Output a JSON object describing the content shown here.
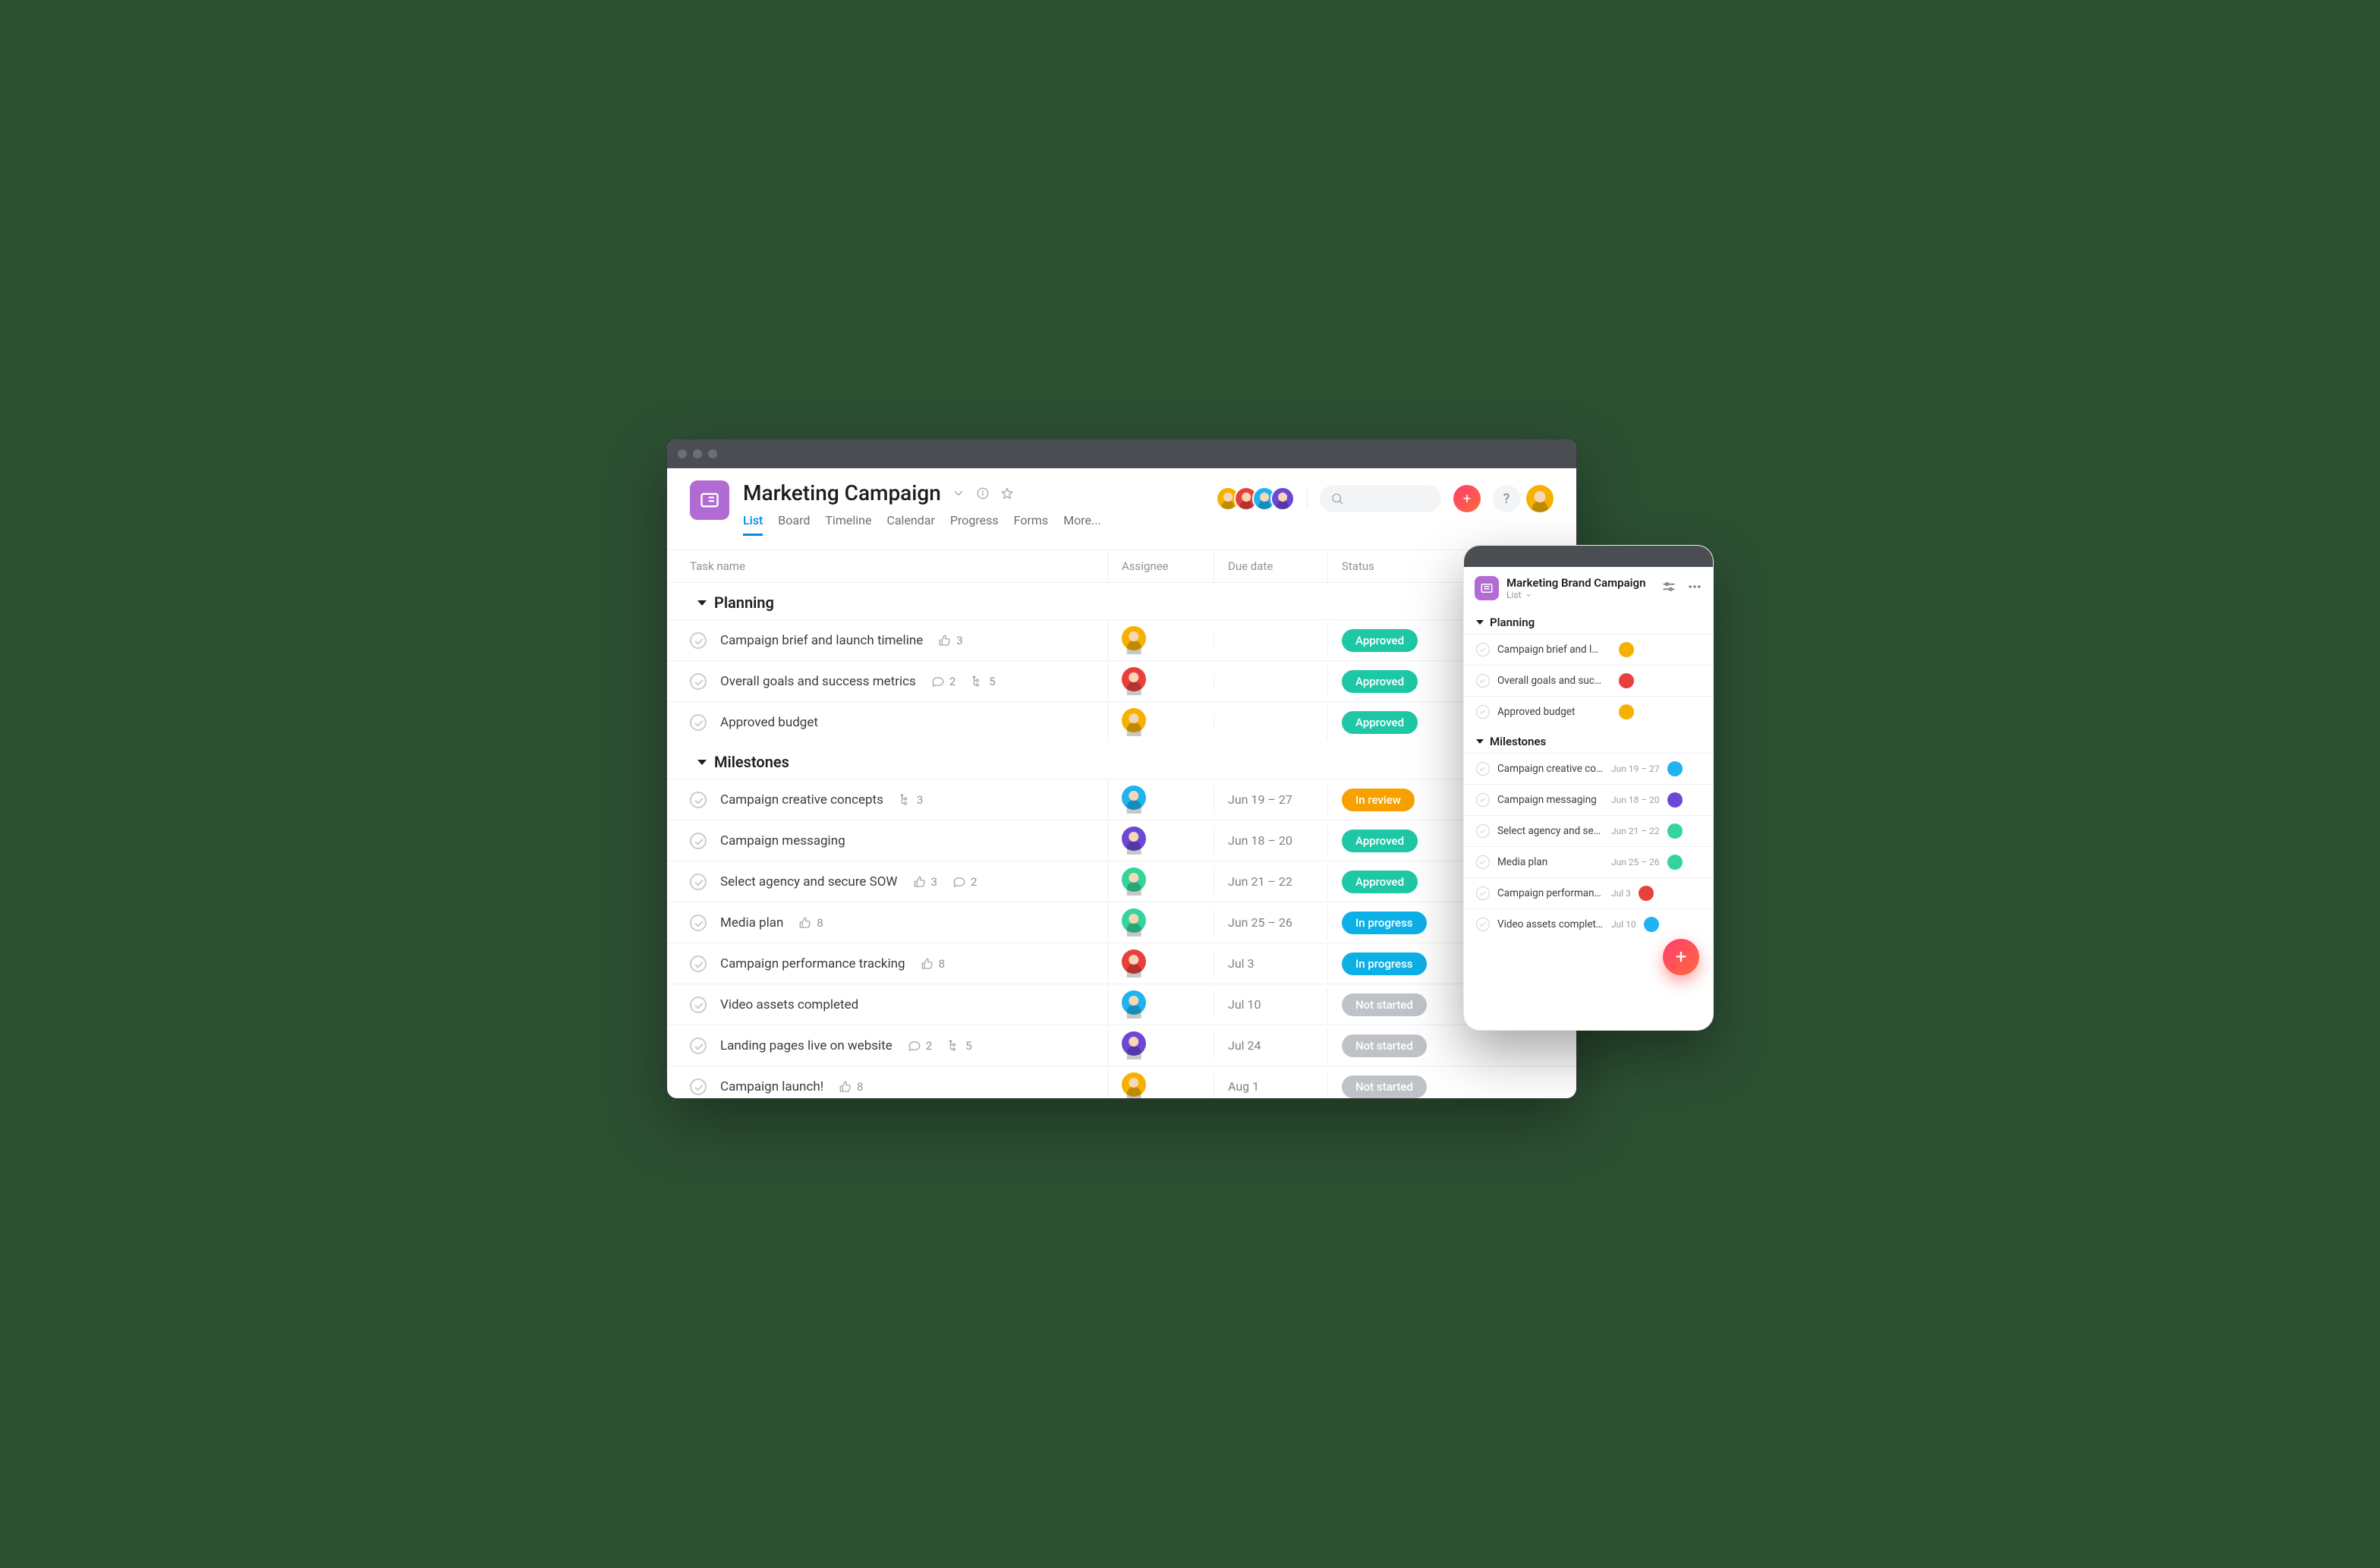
{
  "project": {
    "title": "Marketing Campaign",
    "tabs": [
      "List",
      "Board",
      "Timeline",
      "Calendar",
      "Progress",
      "Forms",
      "More..."
    ],
    "active_tab": 0
  },
  "columns": {
    "task": "Task name",
    "assignee": "Assignee",
    "due": "Due date",
    "status": "Status"
  },
  "status_labels": {
    "approved": "Approved",
    "review": "In review",
    "progress": "In progress",
    "notstarted": "Not started"
  },
  "sections": [
    {
      "name": "Planning",
      "tasks": [
        {
          "name": "Campaign brief and launch timeline",
          "likes": "3",
          "comments": null,
          "subtasks": null,
          "assignee": "yel",
          "due": "",
          "status": "approved"
        },
        {
          "name": "Overall goals and success metrics",
          "likes": null,
          "comments": "2",
          "subtasks": "5",
          "assignee": "red",
          "due": "",
          "status": "approved"
        },
        {
          "name": "Approved budget",
          "likes": null,
          "comments": null,
          "subtasks": null,
          "assignee": "yel",
          "due": "",
          "status": "approved"
        }
      ]
    },
    {
      "name": "Milestones",
      "tasks": [
        {
          "name": "Campaign creative concepts",
          "likes": null,
          "comments": null,
          "subtasks": "3",
          "assignee": "blu",
          "due": "Jun 19 – 27",
          "status": "review"
        },
        {
          "name": "Campaign messaging",
          "likes": null,
          "comments": null,
          "subtasks": null,
          "assignee": "pur",
          "due": "Jun 18 – 20",
          "status": "approved"
        },
        {
          "name": "Select agency and secure SOW",
          "likes": "3",
          "comments": "2",
          "subtasks": null,
          "assignee": "grn",
          "due": "Jun 21 – 22",
          "status": "approved"
        },
        {
          "name": "Media plan",
          "likes": "8",
          "comments": null,
          "subtasks": null,
          "assignee": "grn",
          "due": "Jun 25 – 26",
          "status": "progress"
        },
        {
          "name": "Campaign performance tracking",
          "likes": "8",
          "comments": null,
          "subtasks": null,
          "assignee": "red",
          "due": "Jul 3",
          "status": "progress"
        },
        {
          "name": "Video assets completed",
          "likes": null,
          "comments": null,
          "subtasks": null,
          "assignee": "blu",
          "due": "Jul 10",
          "status": "notstarted"
        },
        {
          "name": "Landing pages live on website",
          "likes": null,
          "comments": "2",
          "subtasks": "5",
          "assignee": "pur",
          "due": "Jul 24",
          "status": "notstarted"
        },
        {
          "name": "Campaign launch!",
          "likes": "8",
          "comments": null,
          "subtasks": null,
          "assignee": "yel",
          "due": "Aug 1",
          "status": "notstarted"
        }
      ]
    }
  ],
  "header_avatars": [
    "yel",
    "red",
    "blu",
    "pur"
  ],
  "mobile": {
    "title": "Marketing Brand Campaign",
    "view": "List",
    "sections": [
      {
        "name": "Planning",
        "tasks": [
          {
            "name": "Campaign brief and launch timeline",
            "due": "",
            "assignee": "yel"
          },
          {
            "name": "Overall goals and success metrics",
            "due": "",
            "assignee": "red"
          },
          {
            "name": "Approved budget",
            "due": "",
            "assignee": "yel"
          }
        ]
      },
      {
        "name": "Milestones",
        "tasks": [
          {
            "name": "Campaign creative concepts",
            "due": "Jun 19 – 27",
            "assignee": "blu"
          },
          {
            "name": "Campaign messaging",
            "due": "Jun 18 – 20",
            "assignee": "pur"
          },
          {
            "name": "Select agency and secure SOW",
            "due": "Jun 21 – 22",
            "assignee": "grn"
          },
          {
            "name": "Media plan",
            "due": "Jun 25 – 26",
            "assignee": "grn"
          },
          {
            "name": "Campaign performance tracking",
            "due": "Jul 3",
            "assignee": "red"
          },
          {
            "name": "Video assets completed",
            "due": "Jul 10",
            "assignee": "blu"
          }
        ]
      }
    ]
  }
}
